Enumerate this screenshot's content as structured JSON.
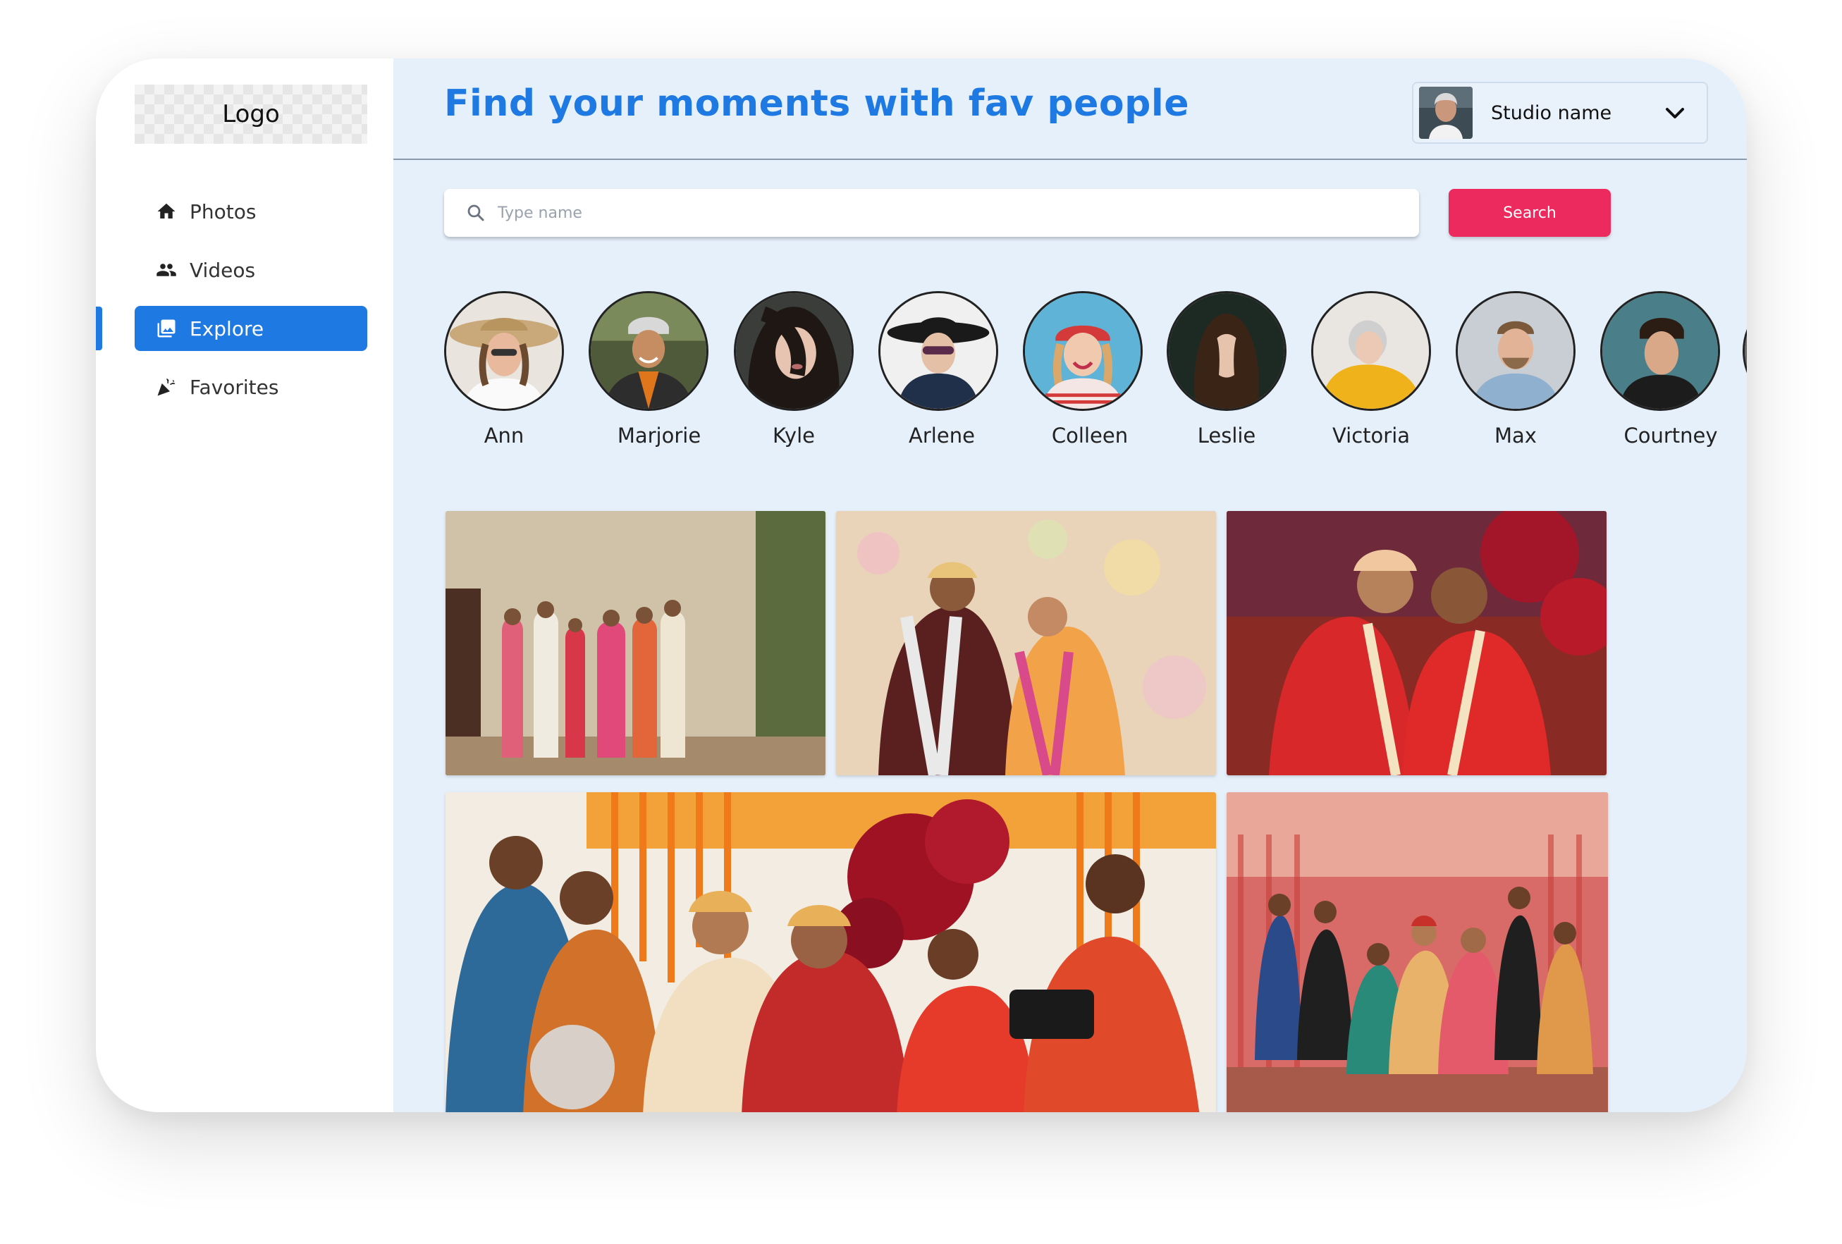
{
  "brand": {
    "logo": "Logo"
  },
  "sidebar": {
    "items": [
      {
        "label": "Photos",
        "icon": "home-icon",
        "active": false
      },
      {
        "label": "Videos",
        "icon": "people-icon",
        "active": false
      },
      {
        "label": "Explore",
        "icon": "gallery-icon",
        "active": true
      },
      {
        "label": "Favorites",
        "icon": "party-popper-icon",
        "active": false
      }
    ]
  },
  "header": {
    "title": "Find your moments with fav people",
    "studio": {
      "name": "Studio name",
      "dropdown_icon": "chevron-down-icon"
    }
  },
  "search": {
    "placeholder": "Type name",
    "value": "",
    "button_label": "Search",
    "icon": "search-icon"
  },
  "people": [
    {
      "name": "Ann"
    },
    {
      "name": "Marjorie"
    },
    {
      "name": "Kyle"
    },
    {
      "name": "Arlene"
    },
    {
      "name": "Colleen"
    },
    {
      "name": "Leslie"
    },
    {
      "name": "Victoria"
    },
    {
      "name": "Max"
    },
    {
      "name": "Courtney"
    }
  ],
  "colors": {
    "accent": "#1e7ae2",
    "search_button": "#ec2a5e",
    "main_background": "#e6f0fb"
  }
}
